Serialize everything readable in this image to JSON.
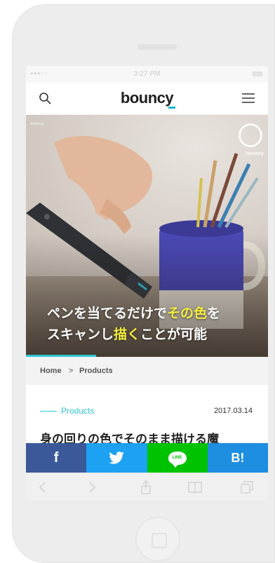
{
  "status_bar": {
    "signal": "●●●○○",
    "time": "3:27 PM"
  },
  "header": {
    "logo": "bouncy"
  },
  "hero": {
    "small_tag": "bouncy",
    "badge_text": "bouncy",
    "caption_line1_a": "ペンを当てるだけで",
    "caption_line1_hl": "その色",
    "caption_line1_b": "を",
    "caption_line2_a": "スキャンし",
    "caption_line2_hl": "描く",
    "caption_line2_b": "ことが可能",
    "highlight_color": "#f3ec3c",
    "slide_progress": 0.29
  },
  "breadcrumb": {
    "home": "Home",
    "separator": ">",
    "current": "Products"
  },
  "article": {
    "category": "Products",
    "date": "2017.03.14",
    "title": "身の回りの色でそのまま描ける魔"
  },
  "share": {
    "facebook": "f",
    "line": "LINE",
    "hatena": "B!",
    "colors": {
      "facebook": "#3b5998",
      "twitter": "#1da1f2",
      "line": "#00c300",
      "hatena": "#1d8ee0"
    }
  },
  "browser_toolbar": {
    "icons": [
      "back-icon",
      "forward-icon",
      "share-icon",
      "bookmarks-icon",
      "tabs-icon"
    ]
  },
  "accent_color": "#2fc7d6"
}
